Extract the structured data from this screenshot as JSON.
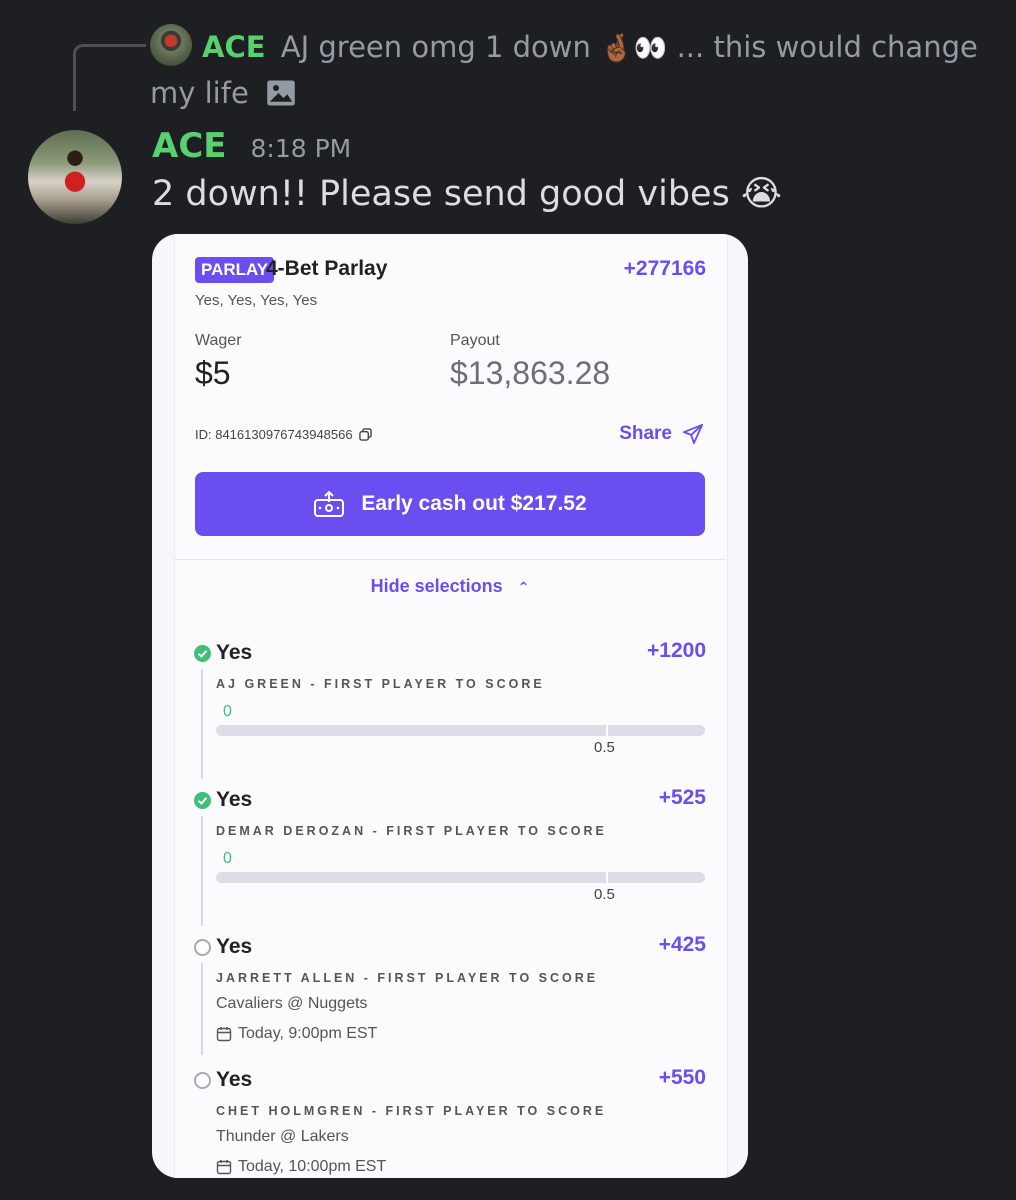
{
  "reply": {
    "username": "ACE",
    "text": "AJ green omg 1 down",
    "emojis": "🤞🏾👀",
    "text_after": "... this would change my life"
  },
  "message": {
    "username": "ACE",
    "timestamp": "8:18 PM",
    "text": "2 down!! Please send good vibes",
    "emoji": "😭"
  },
  "bet": {
    "badge": "PARLAY",
    "title": "4-Bet Parlay",
    "total_odds": "+277166",
    "picks_summary": "Yes, Yes, Yes, Yes",
    "wager_label": "Wager",
    "wager": "$5",
    "payout_label": "Payout",
    "payout": "$13,863.28",
    "id_text": "ID: 8416130976743948566",
    "share_label": "Share",
    "cashout_label": "Early cash out $217.52",
    "hide_selections": "Hide selections",
    "legs": [
      {
        "status": "won",
        "pick": "Yes",
        "odds": "+1200",
        "market": "AJ GREEN - FIRST PLAYER TO SCORE",
        "current": "0",
        "line": "0.5"
      },
      {
        "status": "won",
        "pick": "Yes",
        "odds": "+525",
        "market": "DEMAR DEROZAN - FIRST PLAYER TO SCORE",
        "current": "0",
        "line": "0.5"
      },
      {
        "status": "open",
        "pick": "Yes",
        "odds": "+425",
        "market": "JARRETT ALLEN - FIRST PLAYER TO SCORE",
        "game": "Cavaliers @ Nuggets",
        "when": "Today, 9:00pm EST"
      },
      {
        "status": "open",
        "pick": "Yes",
        "odds": "+550",
        "market": "CHET HOLMGREN - FIRST PLAYER TO SCORE",
        "game": "Thunder @ Lakers",
        "when": "Today, 10:00pm EST"
      }
    ]
  },
  "colors": {
    "background": "#1e1f22",
    "username": "#57d16d",
    "accent": "#6a4ef0",
    "won": "#3fbf77"
  }
}
